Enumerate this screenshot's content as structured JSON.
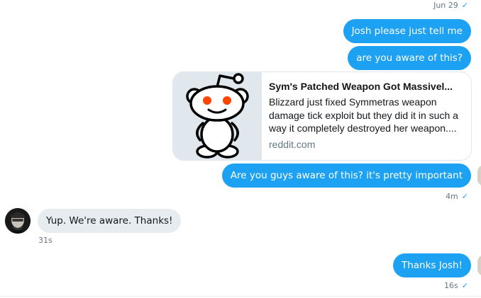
{
  "conversation": {
    "date_label": "Jun 29",
    "messages": [
      {
        "text": "Josh please just tell me"
      },
      {
        "text": "are you aware of this?"
      },
      {
        "text": "Are you guys aware of this? it's pretty important",
        "time": "4m"
      },
      {
        "text": "Yup. We're aware. Thanks!",
        "time": "31s"
      },
      {
        "text": "Thanks Josh!",
        "time": "16s"
      }
    ],
    "link_card": {
      "title": "Sym's Patched Weapon Got Massivel...",
      "description": "Blizzard just fixed Symmetras weapon damage tick exploit but they did it in such a way it completely destroyed her weapon....",
      "domain": "reddit.com",
      "image_icon": "reddit-alien-logo"
    }
  },
  "icons": {
    "read_receipt": "checkmark-icon"
  },
  "colors": {
    "outgoing_bubble": "#1da1f2",
    "incoming_bubble": "#e6ecf0",
    "meta_text": "#657786",
    "card_image_bg": "#e1e8ed",
    "reddit_eyes": "#ff4500"
  }
}
